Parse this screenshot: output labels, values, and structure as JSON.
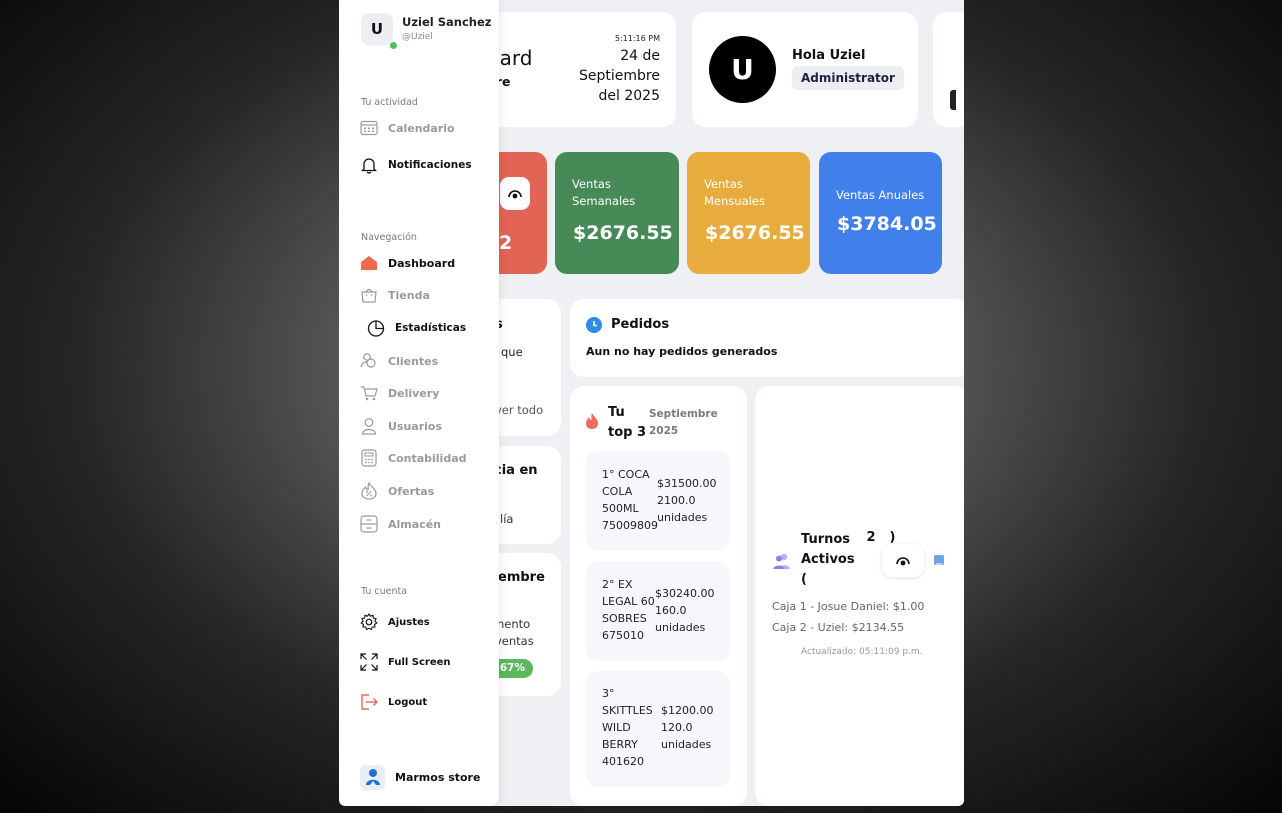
{
  "user": {
    "initial": "U",
    "name": "Uziel Sanchez",
    "handle": "@Uziel"
  },
  "sections": {
    "activity": "Tu actividad",
    "navigation": "Navegación",
    "account": "Tu cuenta"
  },
  "activity_items": [
    {
      "label": "Calendario",
      "icon": "calendar-icon"
    },
    {
      "label": "Notificaciones",
      "icon": "bell-icon"
    }
  ],
  "nav_items": [
    {
      "label": "Dashboard",
      "icon": "home-icon"
    },
    {
      "label": "Tienda",
      "icon": "shopping-bag-icon"
    },
    {
      "label": "Estadísticas",
      "icon": "pie-chart-icon"
    },
    {
      "label": "Clientes",
      "icon": "users-icon"
    },
    {
      "label": "Delivery",
      "icon": "cart-icon"
    },
    {
      "label": "Usuarios",
      "icon": "user-icon"
    },
    {
      "label": "Contabilidad",
      "icon": "calculator-icon"
    },
    {
      "label": "Ofertas",
      "icon": "fire-percent-icon"
    },
    {
      "label": "Almacén",
      "icon": "warehouse-icon"
    }
  ],
  "account_items": [
    {
      "label": "Ajustes",
      "icon": "gear-icon"
    },
    {
      "label": "Full Screen",
      "icon": "fullscreen-icon"
    },
    {
      "label": "Logout",
      "icon": "logout-icon"
    }
  ],
  "store": {
    "name": "Marmos store"
  },
  "header": {
    "title_partial": "hboard",
    "store_partial": "s store",
    "time": "5:11:16 PM",
    "date_line1": "24 de",
    "date_line2": "Septiembre",
    "date_line3": "del 2025"
  },
  "greeting": {
    "initial": "U",
    "text": "Hola Uziel",
    "role": "Administrator"
  },
  "stats": {
    "daily_value_partial": "2",
    "weekly": {
      "label": "Ventas Semanales",
      "value": "$2676.55",
      "color": "#478a58"
    },
    "monthly": {
      "label": "Ventas Mensuales",
      "value": "$2676.55",
      "color": "#e8ac3e"
    },
    "annual": {
      "label": "Ventas Anuales",
      "value": "$3784.05",
      "color": "#4180ea"
    },
    "daily_color": "#e26455"
  },
  "left_cards": {
    "card1_title": "s",
    "card1_text": "que",
    "card1_link": "ver todo",
    "card2_title": "cia en",
    "card2_text": "lía",
    "card3_title": "embre",
    "card3_line1": "nento",
    "card3_line2": "ventas",
    "card3_badge": ".67%"
  },
  "orders": {
    "title": "Pedidos",
    "empty": "Aun no hay pedidos generados"
  },
  "top3": {
    "title_line1": "Tu",
    "title_line2": "top 3",
    "month": "Septiembre",
    "year": "2025",
    "items": [
      {
        "name_lines": [
          "1° COCA",
          "COLA",
          "500ML",
          "75009809"
        ],
        "amount": "$31500.00",
        "qty": "2100.0",
        "unit": "unidades"
      },
      {
        "name_lines": [
          "2° EX",
          "LEGAL 60",
          "SOBRES",
          "675010"
        ],
        "amount": "$30240.00",
        "qty": "160.0",
        "unit": "unidades"
      },
      {
        "name_lines": [
          "3°",
          "SKITTLES",
          "WILD",
          "BERRY",
          "401620"
        ],
        "amount": "$1200.00",
        "qty": "120.0",
        "unit": "unidades"
      }
    ]
  },
  "shifts": {
    "title_line1": "Turnos",
    "title_line2": "Activos",
    "paren_open": "(",
    "count": "2",
    "paren_close": ")",
    "rows": [
      "Caja 1 - Josue Daniel: $1.00",
      "Caja 2 - Uziel: $2134.55"
    ],
    "updated": "Actualizado: 05:11:09 p.m."
  }
}
